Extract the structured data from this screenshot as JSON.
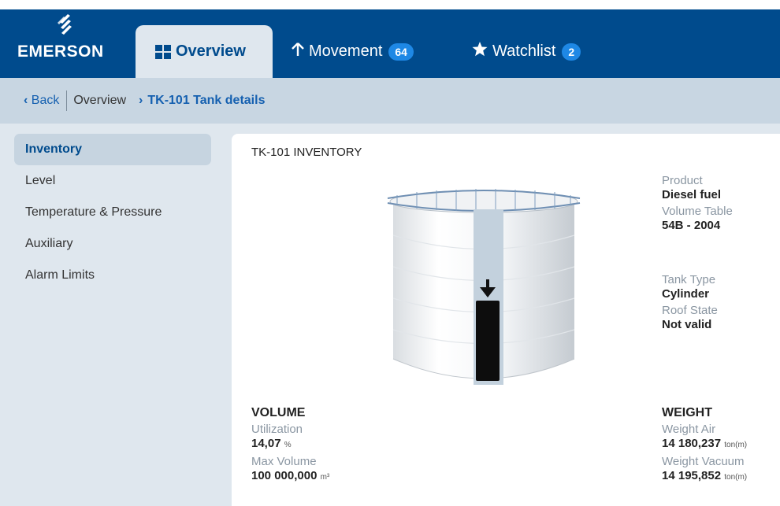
{
  "brand": {
    "name": "EMERSON"
  },
  "tabs": [
    {
      "label": "Overview",
      "icon": "grid-icon"
    },
    {
      "label": "Movement",
      "icon": "arrow-up-icon",
      "badge": "64"
    },
    {
      "label": "Watchlist",
      "icon": "star-icon",
      "badge": "2"
    }
  ],
  "breadcrumb": {
    "back": "Back",
    "overview": "Overview",
    "current": "TK-101 Tank details"
  },
  "sidebar": {
    "items": [
      {
        "label": "Inventory"
      },
      {
        "label": "Level"
      },
      {
        "label": "Temperature & Pressure"
      },
      {
        "label": "Auxiliary"
      },
      {
        "label": "Alarm Limits"
      }
    ]
  },
  "panel": {
    "title": "TK-101 INVENTORY",
    "info": {
      "product_label": "Product",
      "product_value": "Diesel fuel",
      "volume_table_label": "Volume Table",
      "volume_table_value": "54B - 2004",
      "tank_type_label": "Tank Type",
      "tank_type_value": "Cylinder",
      "roof_state_label": "Roof State",
      "roof_state_value": "Not valid"
    },
    "volume": {
      "heading": "VOLUME",
      "utilization_label": "Utilization",
      "utilization_value": "14,07",
      "utilization_unit": "%",
      "max_volume_label": "Max Volume",
      "max_volume_value": "100 000,000",
      "max_volume_unit": "m³"
    },
    "weight": {
      "heading": "WEIGHT",
      "air_label": "Weight Air",
      "air_value": "14 180,237",
      "air_unit": "ton(m)",
      "vacuum_label": "Weight Vacuum",
      "vacuum_value": "14 195,852",
      "vacuum_unit": "ton(m)"
    }
  },
  "colors": {
    "header": "#004b8d",
    "accent": "#1560b0",
    "badge": "#1e88e5"
  }
}
